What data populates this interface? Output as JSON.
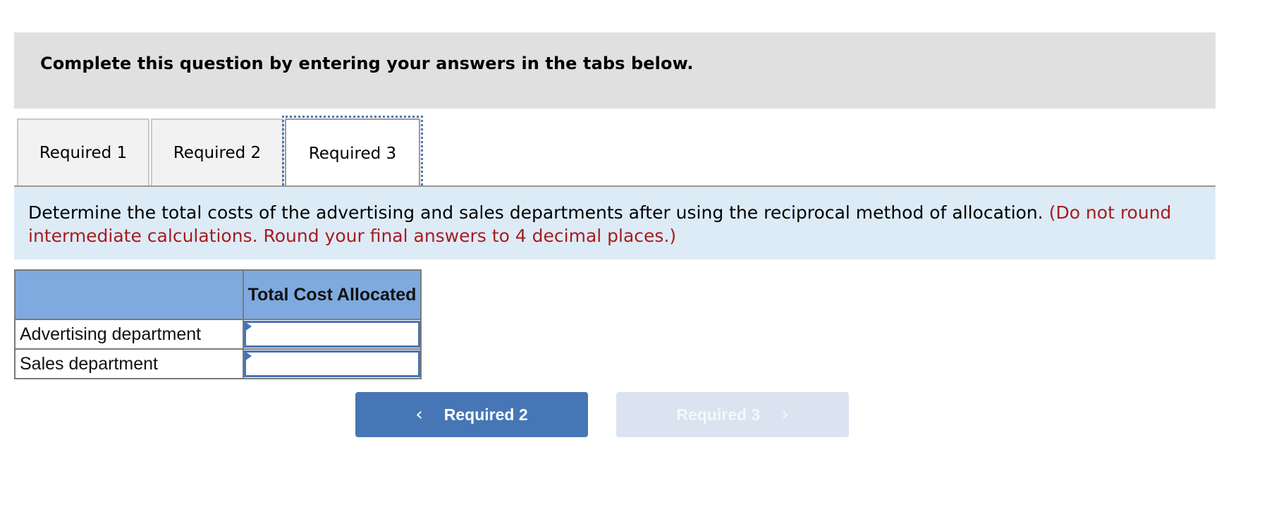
{
  "header": {
    "title": "Complete this question by entering your answers in the tabs below."
  },
  "tabs": [
    {
      "label": "Required 1",
      "active": false
    },
    {
      "label": "Required 2",
      "active": false
    },
    {
      "label": "Required 3",
      "active": true
    }
  ],
  "instructions": {
    "text": "Determine the total costs of the advertising and sales departments after using the reciprocal method of allocation.",
    "note": "(Do not round intermediate calculations. Round your final answers to 4 decimal places.)"
  },
  "table": {
    "headers": [
      "",
      "Total Cost Allocated"
    ],
    "rows": [
      {
        "label": "Advertising department",
        "value": ""
      },
      {
        "label": "Sales department",
        "value": ""
      }
    ]
  },
  "navigation": {
    "prev": {
      "label": "Required 2",
      "icon": "chevron-left-icon",
      "glyph": "‹"
    },
    "next": {
      "label": "Required 3",
      "icon": "chevron-right-icon",
      "glyph": "›",
      "disabled": true
    }
  },
  "colors": {
    "header_bg": "#e0e0e0",
    "instruction_bg": "#ddebf7",
    "note_red": "#a61c1c",
    "table_header_bg": "#7faadf",
    "input_border": "#4773b5",
    "prev_button_bg": "#4676b6",
    "next_button_bg_disabled": "#dae3ef"
  }
}
